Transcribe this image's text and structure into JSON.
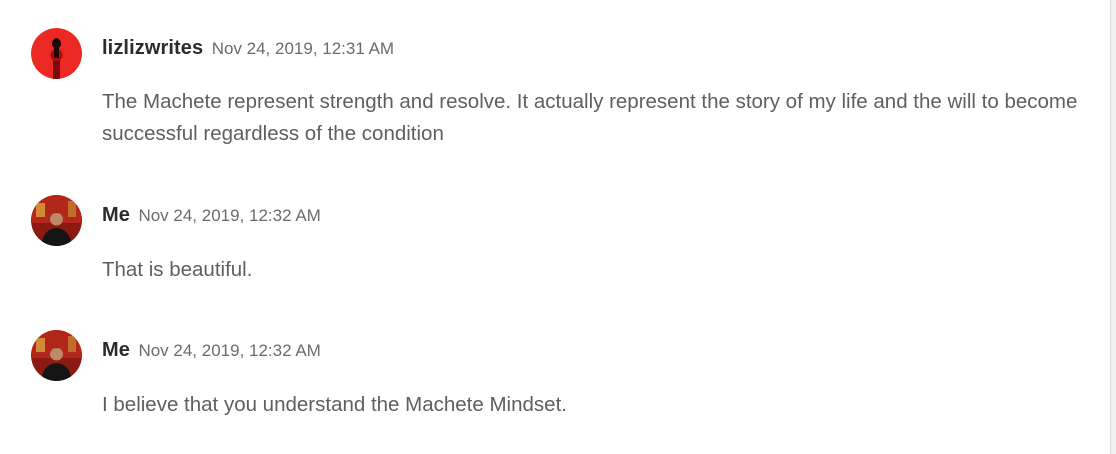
{
  "messages": [
    {
      "author": "lizlizwrites",
      "timestamp": "Nov 24, 2019, 12:31 AM",
      "text": "The Machete represent strength and resolve. It actually represent the story of my life and the will to become successful regardless of the condition",
      "avatar_icon": "user-avatar-red-icon"
    },
    {
      "author": "Me",
      "timestamp": "Nov 24, 2019, 12:32 AM",
      "text": "That is beautiful.",
      "avatar_icon": "user-avatar-photo-icon"
    },
    {
      "author": "Me",
      "timestamp": "Nov 24, 2019, 12:32 AM",
      "text": "I believe that you understand the Machete Mindset.",
      "avatar_icon": "user-avatar-photo-icon"
    }
  ],
  "colors": {
    "author": "#2b2b2b",
    "timestamp": "#6b6b6b",
    "body_text": "#5f5f5f",
    "avatar_red": "#e02020"
  }
}
